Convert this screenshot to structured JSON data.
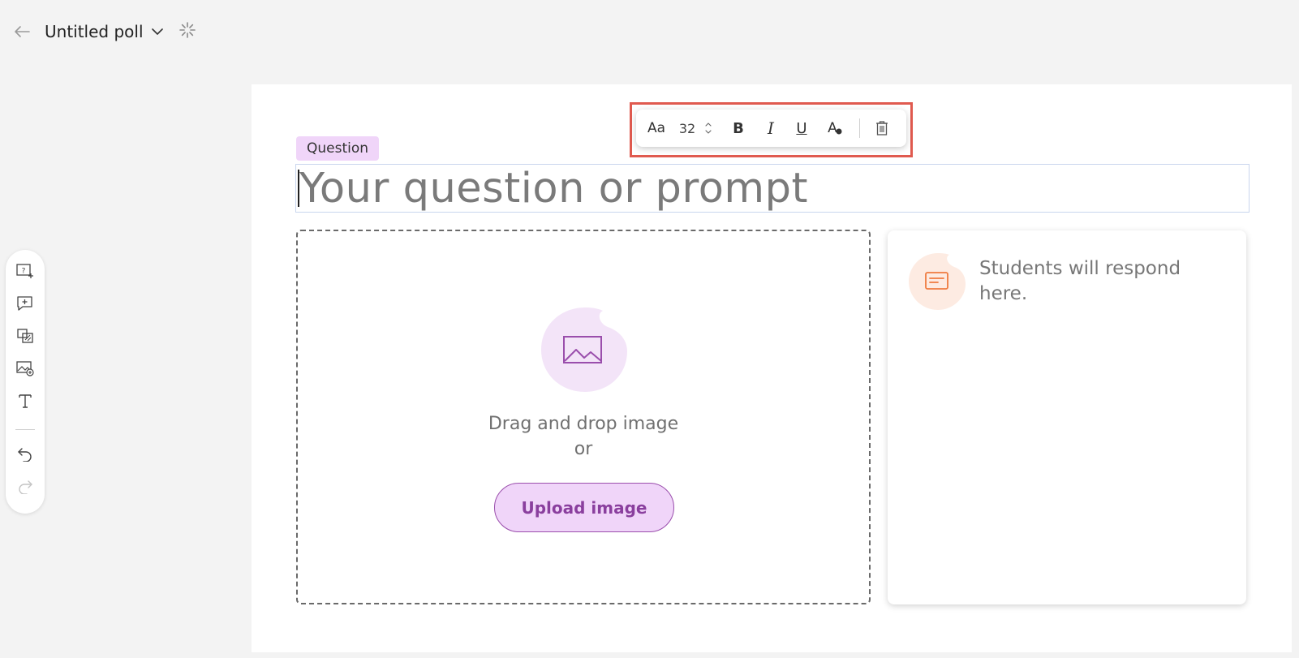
{
  "header": {
    "title": "Untitled poll"
  },
  "editor": {
    "badge": "Question",
    "question_placeholder": "Your question or prompt"
  },
  "format_toolbar": {
    "font_icon": "Aa",
    "font_size": "32",
    "bold_label": "B",
    "italic_label": "I",
    "underline_label": "U",
    "color_icon": "A"
  },
  "image_drop": {
    "text_line1": "Drag and drop image",
    "text_line2": "or",
    "upload_label": "Upload image"
  },
  "response": {
    "text_line1": "Students will respond",
    "text_line2": "here."
  },
  "side_toolbar": {
    "items": [
      "add-question-icon",
      "add-comment-icon",
      "duplicate-icon",
      "add-image-icon",
      "text-icon",
      "undo-icon",
      "redo-icon"
    ]
  },
  "colors": {
    "accent": "#9a4eac",
    "accent_light": "#f0d5f9",
    "highlight": "#e05a4f",
    "response_icon": "#ef7b3f"
  }
}
